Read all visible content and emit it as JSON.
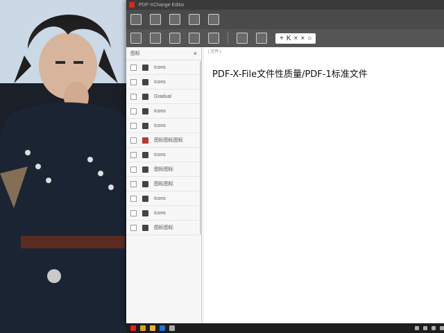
{
  "window": {
    "title": "PDF-XChange Editor",
    "doc_header": "| 文件 |"
  },
  "toolbar": {
    "row1_icons": [
      "undo-icon",
      "home-icon",
      "file-icon",
      "bookmark-icon",
      "text-icon"
    ],
    "row2_icons": [
      "save-icon",
      "print-icon",
      "copy-icon",
      "export-icon",
      "stamp-icon",
      "page-icon",
      "edit-icon"
    ],
    "mode_items": [
      "+",
      "K",
      "×",
      "×",
      "○"
    ]
  },
  "sidebar": {
    "header_label": "图标",
    "close_label": "×",
    "items": [
      {
        "label": "Icons",
        "thumb": "dark"
      },
      {
        "label": "Icons",
        "thumb": "dark"
      },
      {
        "label": "Gradual",
        "thumb": "dark"
      },
      {
        "label": "Icons",
        "thumb": "dark"
      },
      {
        "label": "Icons",
        "thumb": "dark"
      },
      {
        "label": "图标图标图标",
        "thumb": "red"
      },
      {
        "label": "Icons",
        "thumb": "dark"
      },
      {
        "label": "图标图标",
        "thumb": "dark"
      },
      {
        "label": "图标图标",
        "thumb": "dark"
      },
      {
        "label": "Icons",
        "thumb": "dark"
      },
      {
        "label": "Icons",
        "thumb": "dark"
      },
      {
        "label": "图标图标",
        "thumb": "dark"
      }
    ]
  },
  "document": {
    "title": "PDF-X-File文件性质量/PDF-1标准文件"
  },
  "taskbar": {
    "icons": [
      "start-icon",
      "search-icon",
      "folder-icon",
      "browser-icon",
      "pdf-icon",
      "tray-up-icon",
      "wifi-icon",
      "volume-icon",
      "clock-icon"
    ]
  },
  "colors": {
    "brand": "#e2231a",
    "toolbar": "#4a4a4a",
    "panel": "#f7f7f7"
  }
}
